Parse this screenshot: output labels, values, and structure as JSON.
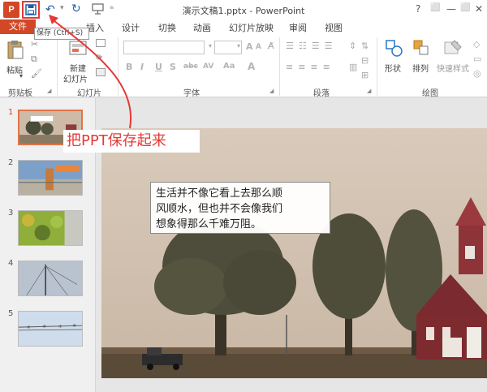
{
  "titlebar": {
    "app_icon_label": "P",
    "title": "演示文稿1.pptx - PowerPoint",
    "window_controls": [
      "?",
      "⬜",
      "—",
      "⬜",
      "✕"
    ]
  },
  "tabs": {
    "file": "文件",
    "items": [
      "插入",
      "设计",
      "切换",
      "动画",
      "幻灯片放映",
      "审阅",
      "视图"
    ]
  },
  "tooltip": "保存 (Ctrl+S)",
  "ribbon": {
    "clipboard": {
      "paste_label": "粘贴",
      "group": "剪贴板"
    },
    "slides": {
      "new_slide_line1": "新建",
      "new_slide_line2": "幻灯片",
      "group": "幻灯片"
    },
    "font": {
      "group": "字体",
      "glyphs": [
        "B",
        "I",
        "U",
        "S",
        "abc",
        "AV",
        "Aa",
        "A",
        "A"
      ]
    },
    "paragraph": {
      "group": "段落"
    },
    "drawing": {
      "shapes": "形状",
      "arrange": "排列",
      "quick_styles": "快速样式",
      "group": "绘图"
    }
  },
  "thumbnails": [
    {
      "num": "1"
    },
    {
      "num": "2"
    },
    {
      "num": "3"
    },
    {
      "num": "4"
    },
    {
      "num": "5"
    }
  ],
  "slide": {
    "text_line1": "生活并不像它看上去那么顺",
    "text_line2": "风顺水，但也并不会像我们",
    "text_line3": "想象得那么千难万阻。"
  },
  "annotation": "把PPT保存起来",
  "colors": {
    "accent": "#d24726",
    "annotation": "#e53935",
    "selection": "#e0744a"
  }
}
